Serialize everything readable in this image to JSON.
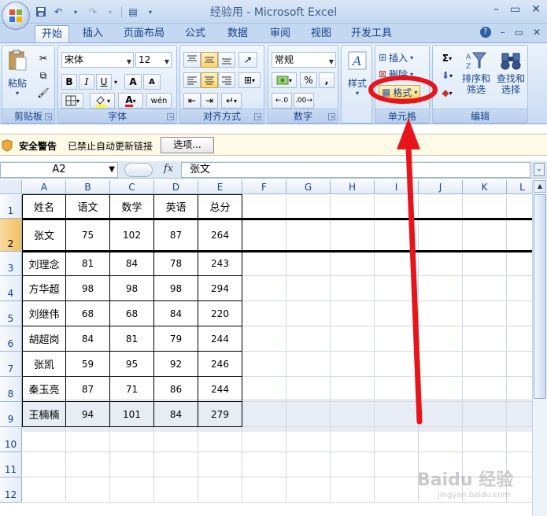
{
  "window": {
    "title": "经验用 - Microsoft Excel"
  },
  "tabs": [
    {
      "label": "开始"
    },
    {
      "label": "插入"
    },
    {
      "label": "页面布局"
    },
    {
      "label": "公式"
    },
    {
      "label": "数据"
    },
    {
      "label": "审阅"
    },
    {
      "label": "视图"
    },
    {
      "label": "开发工具"
    }
  ],
  "ribbon": {
    "clipboard": {
      "label": "剪贴板",
      "paste": "粘贴"
    },
    "font": {
      "label": "字体",
      "name": "宋体",
      "size": "12",
      "bold": "B",
      "italic": "I",
      "underline": "U",
      "grow": "A",
      "shrink": "A",
      "color_a": "A"
    },
    "align": {
      "label": "对齐方式"
    },
    "number": {
      "label": "数字",
      "format": "常规",
      "percent": "%",
      "comma": ","
    },
    "styles": {
      "label": "样式"
    },
    "cells": {
      "label": "单元格",
      "insert": "插入",
      "delete": "删除",
      "format": "格式"
    },
    "edit": {
      "label": "编辑",
      "sigma": "Σ",
      "sort": "排序和\n筛选",
      "find": "查找和\n选择",
      "sort1": "排序和",
      "sort2": "筛选",
      "find1": "查找和",
      "find2": "选择"
    }
  },
  "security": {
    "title": "安全警告",
    "message": "已禁止自动更新链接",
    "options": "选项..."
  },
  "formula_bar": {
    "name_box": "A2",
    "fx": "fx",
    "content": "张文"
  },
  "grid": {
    "columns": [
      "A",
      "B",
      "C",
      "D",
      "E",
      "F",
      "G",
      "H",
      "I",
      "J",
      "K",
      "L"
    ],
    "rows": [
      "1",
      "2",
      "3",
      "4",
      "5",
      "6",
      "7",
      "8",
      "9",
      "10",
      "11",
      "12"
    ],
    "header": [
      "姓名",
      "语文",
      "数学",
      "英语",
      "总分"
    ],
    "data": [
      [
        "张文",
        "75",
        "102",
        "87",
        "264"
      ],
      [
        "刘理念",
        "81",
        "84",
        "78",
        "243"
      ],
      [
        "方华超",
        "98",
        "98",
        "98",
        "294"
      ],
      [
        "刘继伟",
        "68",
        "68",
        "84",
        "220"
      ],
      [
        "胡超岗",
        "84",
        "81",
        "79",
        "244"
      ],
      [
        "张凯",
        "59",
        "95",
        "92",
        "246"
      ],
      [
        "秦玉亮",
        "87",
        "71",
        "86",
        "244"
      ],
      [
        "王楠楠",
        "94",
        "101",
        "84",
        "279"
      ]
    ]
  },
  "colors": {
    "annotation": "#e8141b",
    "ribbon_text": "#15428b",
    "selected_header": "#f1c15f"
  },
  "watermark": {
    "line1": "Baidu 经验",
    "line2": "jingyan.baidu.com"
  }
}
